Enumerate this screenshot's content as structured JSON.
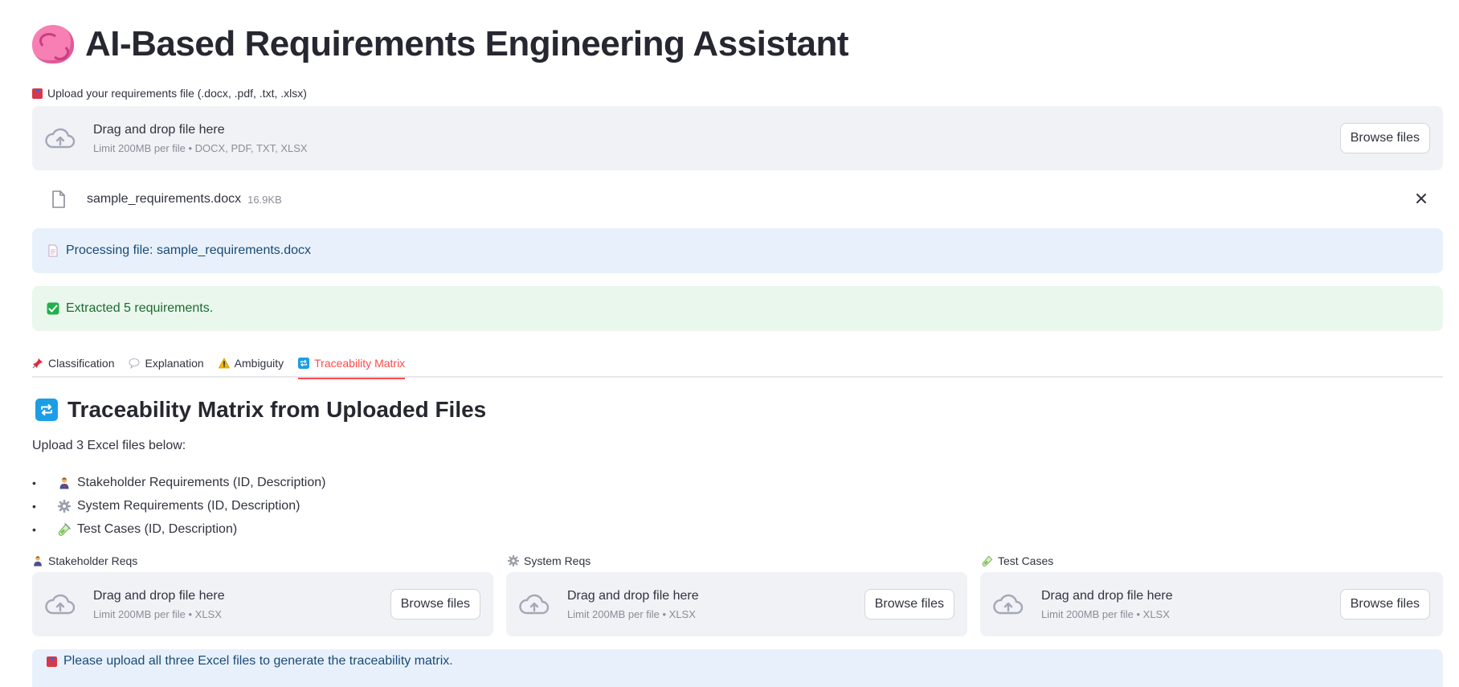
{
  "app": {
    "title": "AI-Based Requirements Engineering Assistant",
    "title_icon": "brain-icon"
  },
  "main_uploader": {
    "label": "Upload your requirements file (.docx, .pdf, .txt, .xlsx)",
    "drop_text": "Drag and drop file here",
    "limit_text": "Limit 200MB per file • DOCX, PDF, TXT, XLSX",
    "browse_label": "Browse files"
  },
  "uploaded_file": {
    "name": "sample_requirements.docx",
    "size": "16.9KB"
  },
  "alerts": {
    "processing": "Processing file: sample_requirements.docx",
    "extracted": "Extracted 5 requirements."
  },
  "tabs": [
    {
      "label": "Classification",
      "icon": "pushpin-icon",
      "active": false
    },
    {
      "label": "Explanation",
      "icon": "speech-bubble-icon",
      "active": false
    },
    {
      "label": "Ambiguity",
      "icon": "warning-icon",
      "active": false
    },
    {
      "label": "Traceability Matrix",
      "icon": "repeat-icon",
      "active": true
    }
  ],
  "trace": {
    "title": "Traceability Matrix from Uploaded Files",
    "intro": "Upload 3 Excel files below:",
    "bullets": [
      {
        "icon": "stakeholder-icon",
        "text": "Stakeholder Requirements (ID, Description)"
      },
      {
        "icon": "gear-icon",
        "text": "System Requirements (ID, Description)"
      },
      {
        "icon": "test-tube-icon",
        "text": "Test Cases (ID, Description)"
      }
    ],
    "uploaders": [
      {
        "label": "Stakeholder Reqs",
        "icon": "stakeholder-icon",
        "drop_text": "Drag and drop file here",
        "limit_text": "Limit 200MB per file • XLSX",
        "browse_label": "Browse files"
      },
      {
        "label": "System Reqs",
        "icon": "gear-icon",
        "drop_text": "Drag and drop file here",
        "limit_text": "Limit 200MB per file • XLSX",
        "browse_label": "Browse files"
      },
      {
        "label": "Test Cases",
        "icon": "test-tube-icon",
        "drop_text": "Drag and drop file here",
        "limit_text": "Limit 200MB per file • XLSX",
        "browse_label": "Browse files"
      }
    ],
    "notice": "Please upload all three Excel files to generate the traceability matrix."
  },
  "colors": {
    "accent": "#ff4b4b",
    "dropzone_bg": "#f0f2f6",
    "info_bg": "#e8f1fb",
    "success_bg": "#e9f7ec"
  }
}
